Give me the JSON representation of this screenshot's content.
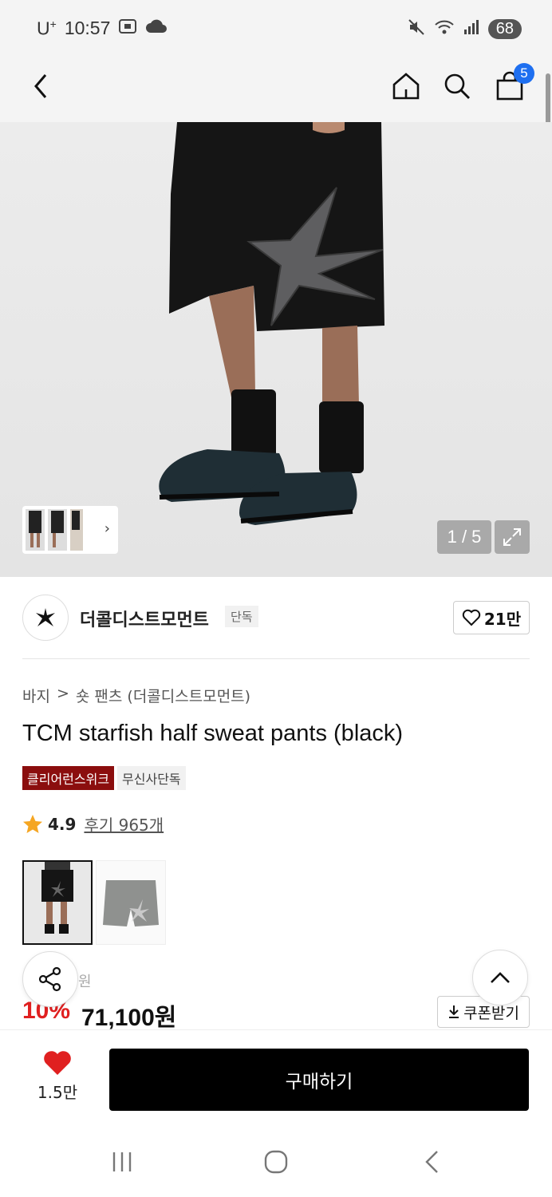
{
  "status": {
    "carrier": "U",
    "carrier_sup": "+",
    "time": "10:57",
    "battery": "68"
  },
  "header": {
    "cart_count": "5"
  },
  "gallery": {
    "counter": "1 / 5"
  },
  "brand": {
    "name": "더콜디스트모먼트",
    "tag": "단독",
    "likes": "21만"
  },
  "product": {
    "breadcrumb_category": "바지",
    "breadcrumb_sep": ">",
    "breadcrumb_sub": "숏 팬츠 (더콜디스트모먼트)",
    "title": "TCM starfish half sweat pants (black)",
    "tag_event": "클리어런스위크",
    "tag_exclusive": "무신사단독",
    "rating": "4.9",
    "reviews": "후기 965개"
  },
  "price": {
    "original_suffix": "원",
    "discount": "10%",
    "final": "71,100원",
    "coupon_label": "쿠폰받기"
  },
  "bottom": {
    "like_count": "1.5만",
    "buy_label": "구매하기"
  },
  "colors": {
    "accent_red": "#e02020",
    "badge_blue": "#1e6ff0",
    "tag_red": "#8b0e0e"
  }
}
